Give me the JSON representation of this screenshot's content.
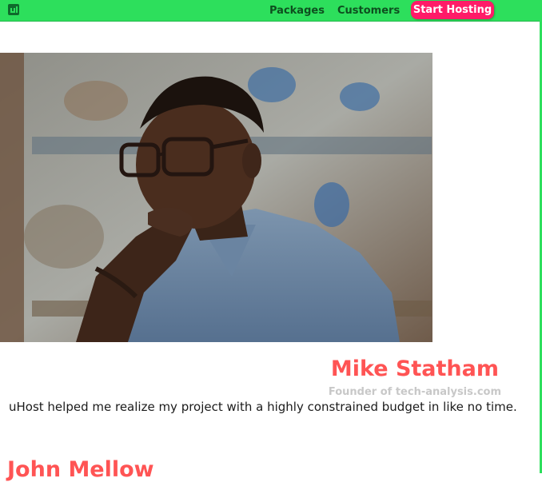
{
  "nav": {
    "links": [
      "Packages",
      "Customers"
    ],
    "cta_label": "Start Hosting"
  },
  "testimonial": {
    "name": "Mike Statham",
    "role": "Founder of tech-analysis.com",
    "quote": "uHost helped me realize my project with a highly constrained budget in like no time."
  },
  "next_testimonial": {
    "name": "John Mellow"
  },
  "colors": {
    "topbar": "#2ddf5c",
    "cta": "#ff1b68",
    "name": "#ff5454",
    "role": "#c8c8c8"
  },
  "icons": {
    "logo": "uhost-logo-icon"
  }
}
